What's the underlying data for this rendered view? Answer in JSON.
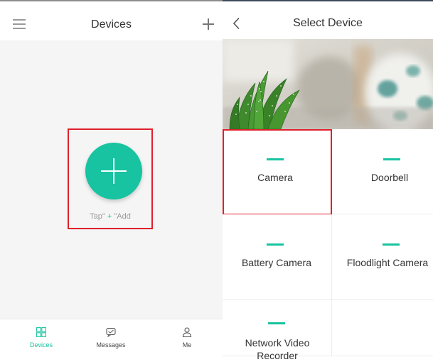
{
  "left_screen": {
    "title": "Devices",
    "add_hint": {
      "prefix": "Tap\"",
      "plus": " + ",
      "suffix": "\"Add"
    },
    "nav": [
      {
        "label": "Devices",
        "icon": "grid-icon",
        "active": true
      },
      {
        "label": "Messages",
        "icon": "message-icon",
        "active": false
      },
      {
        "label": "Me",
        "icon": "person-icon",
        "active": false
      }
    ]
  },
  "right_screen": {
    "title": "Select Device",
    "devices": [
      {
        "label": "Camera",
        "selected": true
      },
      {
        "label": "Doorbell",
        "selected": false
      },
      {
        "label": "Battery Camera",
        "selected": false
      },
      {
        "label": "Floodlight Camera",
        "selected": false
      },
      {
        "label": "Network Video Recorder",
        "selected": false
      }
    ]
  },
  "colors": {
    "accent": "#17c3a0",
    "highlight_box": "#e0202d",
    "background": "#f5f5f5"
  }
}
